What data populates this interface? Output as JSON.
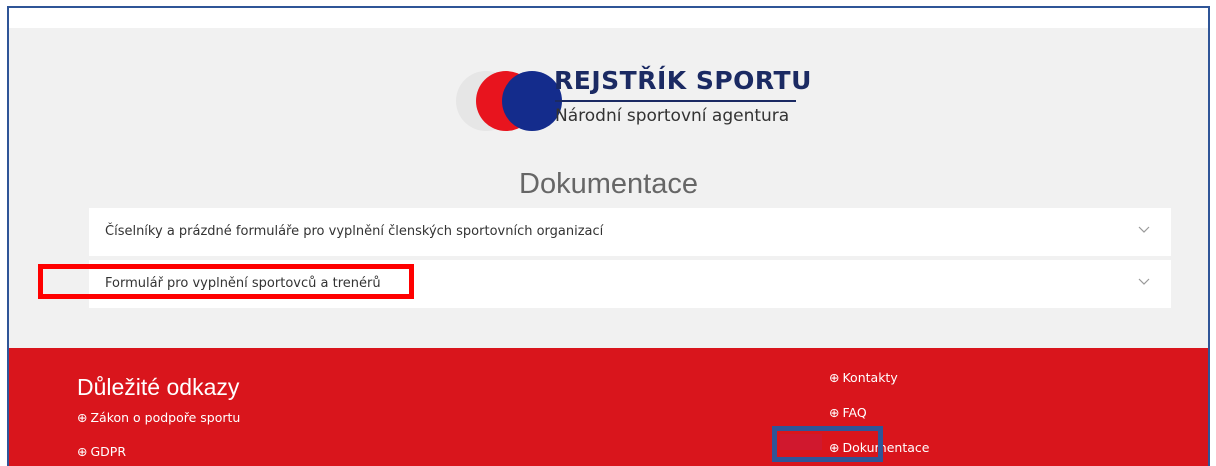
{
  "logo": {
    "title": "REJSTŘÍK SPORTU",
    "subtitle": "Národní sportovní agentura",
    "colors": {
      "grey": "#e6e6e6",
      "red": "#e8141e",
      "blue": "#142c8c"
    }
  },
  "page": {
    "title": "Dokumentace"
  },
  "accordion": {
    "items": [
      {
        "label": "Číselníky a prázdné formuláře pro vyplnění členských sportovních organizací",
        "icon": "chevron-down-icon"
      },
      {
        "label": "Formulář pro vyplnění sportovců a trenérů",
        "icon": "chevron-down-icon"
      }
    ]
  },
  "footer": {
    "heading": "Důležité odkazy",
    "background": "#d9151c",
    "left_links": [
      {
        "label": "Zákon o podpoře sportu",
        "icon": "circle-arrow-right-icon"
      },
      {
        "label": "GDPR",
        "icon": "circle-arrow-right-icon"
      }
    ],
    "right_links": [
      {
        "label": "Kontakty",
        "icon": "circle-arrow-right-icon"
      },
      {
        "label": "FAQ",
        "icon": "circle-arrow-right-icon"
      },
      {
        "label": "Dokumentace",
        "icon": "circle-arrow-right-icon"
      }
    ]
  },
  "annotations": {
    "red_box_color": "#ff0000",
    "blue_box_color": "#2f5597"
  },
  "icons": {
    "link_glyph": "⊕"
  }
}
